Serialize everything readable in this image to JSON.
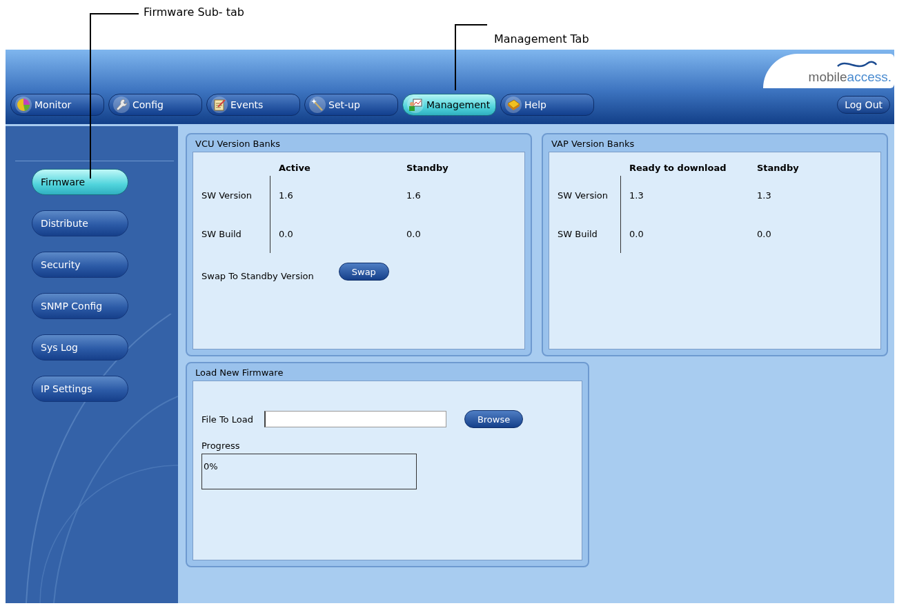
{
  "callouts": [
    {
      "text": "Firmware Sub- tab"
    },
    {
      "text": "Management Tab"
    }
  ],
  "header": {
    "logo_prefix": "mobile",
    "logo_suffix": "access.",
    "logout": "Log Out",
    "tabs": [
      {
        "label": "Monitor",
        "selected": false
      },
      {
        "label": "Config",
        "selected": false
      },
      {
        "label": "Events",
        "selected": false
      },
      {
        "label": "Set-up",
        "selected": false
      },
      {
        "label": "Management",
        "selected": true
      },
      {
        "label": "Help",
        "selected": false
      }
    ]
  },
  "sidebar": {
    "items": [
      {
        "label": "Firmware",
        "selected": true
      },
      {
        "label": "Distribute",
        "selected": false
      },
      {
        "label": "Security",
        "selected": false
      },
      {
        "label": "SNMP Config",
        "selected": false
      },
      {
        "label": "Sys Log",
        "selected": false
      },
      {
        "label": "IP Settings",
        "selected": false
      }
    ]
  },
  "vcu_banks": {
    "title": "VCU Version Banks",
    "columns": [
      "Active",
      "Standby"
    ],
    "rows": [
      {
        "label": "SW Version",
        "values": [
          "1.6",
          "1.6"
        ]
      },
      {
        "label": "SW Build",
        "values": [
          "0.0",
          "0.0"
        ]
      }
    ],
    "swap_label": "Swap To Standby Version",
    "swap_button": "Swap"
  },
  "vap_banks": {
    "title": "VAP Version Banks",
    "columns": [
      "Ready to download",
      "Standby"
    ],
    "rows": [
      {
        "label": "SW Version",
        "values": [
          "1.3",
          "1.3"
        ]
      },
      {
        "label": "SW Build",
        "values": [
          "0.0",
          "0.0"
        ]
      }
    ]
  },
  "load_firmware": {
    "title": "Load New Firmware",
    "file_label": "File To Load",
    "browse_button": "Browse",
    "progress_label": "Progress",
    "progress": {
      "level": 0,
      "reading": "0%"
    }
  }
}
